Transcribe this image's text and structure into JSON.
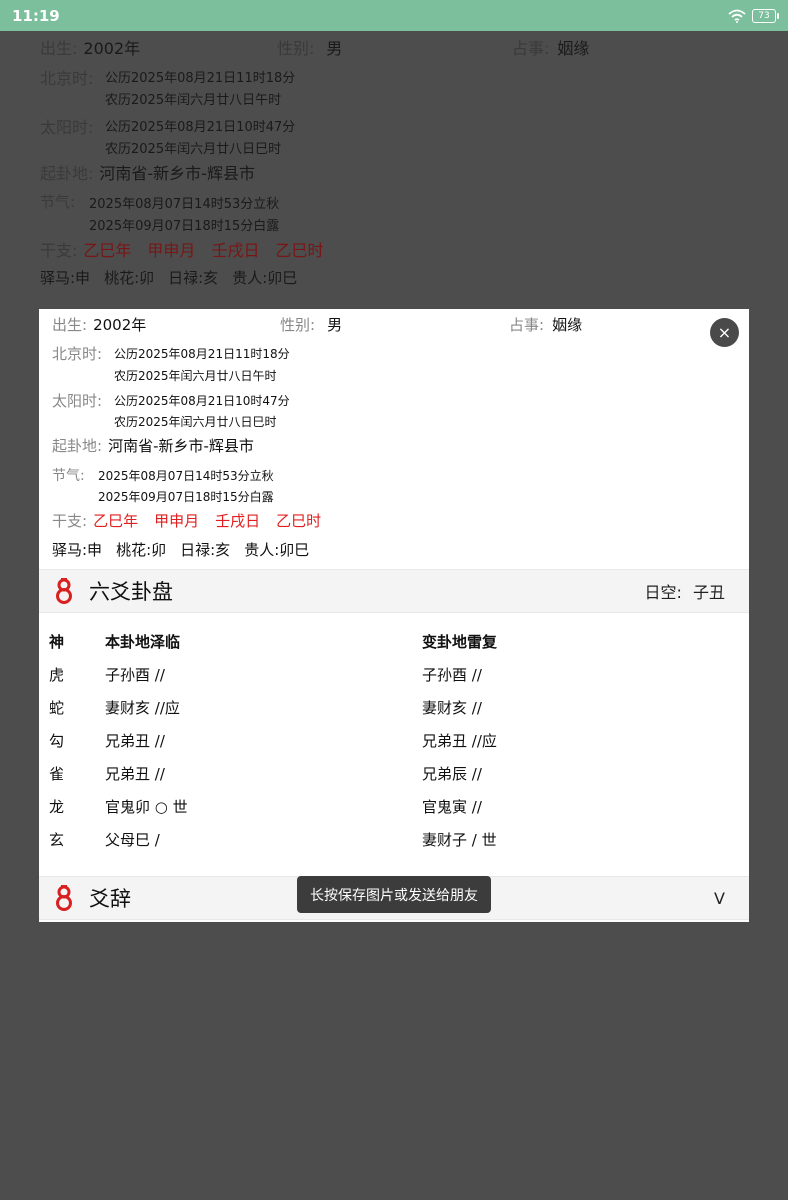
{
  "status": {
    "time": "11:19",
    "battery": "73"
  },
  "info": {
    "birth_label": "出生:",
    "birth_value": "2002年",
    "gender_label": "性别:",
    "gender_value": "男",
    "matter_label": "占事:",
    "matter_value": "姻缘",
    "beijing_label": "北京时:",
    "beijing_line1": "公历2025年08月21日11时18分",
    "beijing_line2": "农历2025年闰六月廿八日午时",
    "solar_label": "太阳时:",
    "solar_line1": "公历2025年08月21日10时47分",
    "solar_line2": "农历2025年闰六月廿八日巳时",
    "place_label": "起卦地:",
    "place_value": "河南省-新乡市-辉县市",
    "jieqi_label": "节气:",
    "jieqi_line1": "2025年08月07日14时53分立秋",
    "jieqi_line2": "2025年09月07日18时15分白露",
    "ganzhi_label": "干支:",
    "ganzhi": [
      "乙巳年",
      "甲申月",
      "壬戌日",
      "乙巳时"
    ],
    "shensha": [
      "驿马:申",
      "桃花:卯",
      "日禄:亥",
      "贵人:卯巳"
    ]
  },
  "dialog": {
    "close_symbol": "×",
    "liuyao_title": "六爻卦盘",
    "rikong_label": "日空:",
    "rikong_value": "子丑",
    "table": {
      "headers": [
        "神",
        "本卦地泽临",
        "变卦地雷复"
      ],
      "rows": [
        [
          "虎",
          "子孙酉 //",
          "子孙酉 //"
        ],
        [
          "蛇",
          "妻财亥 //应",
          "妻财亥 //"
        ],
        [
          "勾",
          "兄弟丑 //",
          "兄弟丑 //应"
        ],
        [
          "雀",
          "兄弟丑 //",
          "兄弟辰 //"
        ],
        [
          "龙",
          "官鬼卯 ○ 世",
          "官鬼寅 //"
        ],
        [
          "玄",
          "父母巳  /",
          "妻财子  / 世"
        ]
      ]
    },
    "yaoci_title": "爻辞",
    "expand_symbol": "V"
  },
  "toast": "长按保存图片或发送给朋友",
  "colors": {
    "status_bar": "#7cbf9c",
    "accent_red": "#e02020",
    "overlay": "#4d4d4d"
  },
  "icons": {
    "section_icon": "red-gourd-icon",
    "wifi": "wifi-icon",
    "battery": "battery-icon"
  }
}
